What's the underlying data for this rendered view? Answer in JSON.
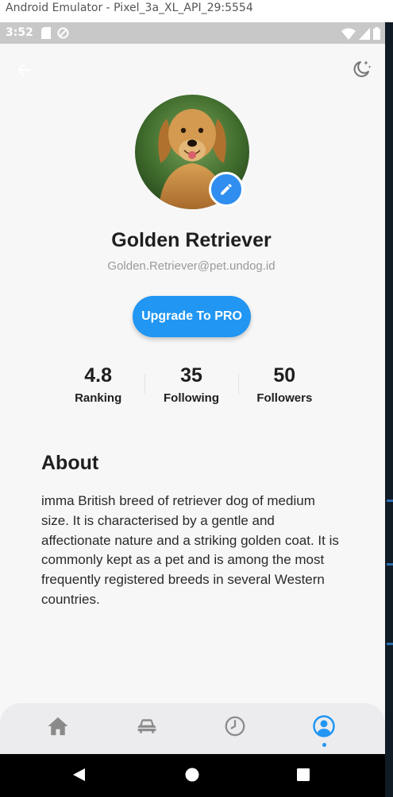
{
  "window": {
    "title": "Android Emulator - Pixel_3a_XL_API_29:5554"
  },
  "status_bar": {
    "time": "3:52"
  },
  "profile": {
    "name": "Golden Retriever",
    "email": "Golden.Retriever@pet.undog.id",
    "upgrade_label": "Upgrade To PRO"
  },
  "stats": [
    {
      "value": "4.8",
      "label": "Ranking"
    },
    {
      "value": "35",
      "label": "Following"
    },
    {
      "value": "50",
      "label": "Followers"
    }
  ],
  "about": {
    "title": "About",
    "text": "imma British breed of retriever dog of medium size. It is characterised by a gentle and affectionate nature and a striking golden coat. It is commonly kept as a pet and is among the most frequently registered breeds in several Western countries."
  },
  "bottom_nav": {
    "items": [
      {
        "icon": "home-icon",
        "active": false
      },
      {
        "icon": "car-icon",
        "active": false
      },
      {
        "icon": "clock-icon",
        "active": false
      },
      {
        "icon": "profile-icon",
        "active": true
      }
    ]
  },
  "colors": {
    "accent": "#2196f3",
    "text_primary": "#1f1f1f",
    "text_secondary": "#9a9a9a",
    "background": "#f7f7f7",
    "nav_background": "#ececef",
    "inactive_icon": "#8a8a8a"
  }
}
